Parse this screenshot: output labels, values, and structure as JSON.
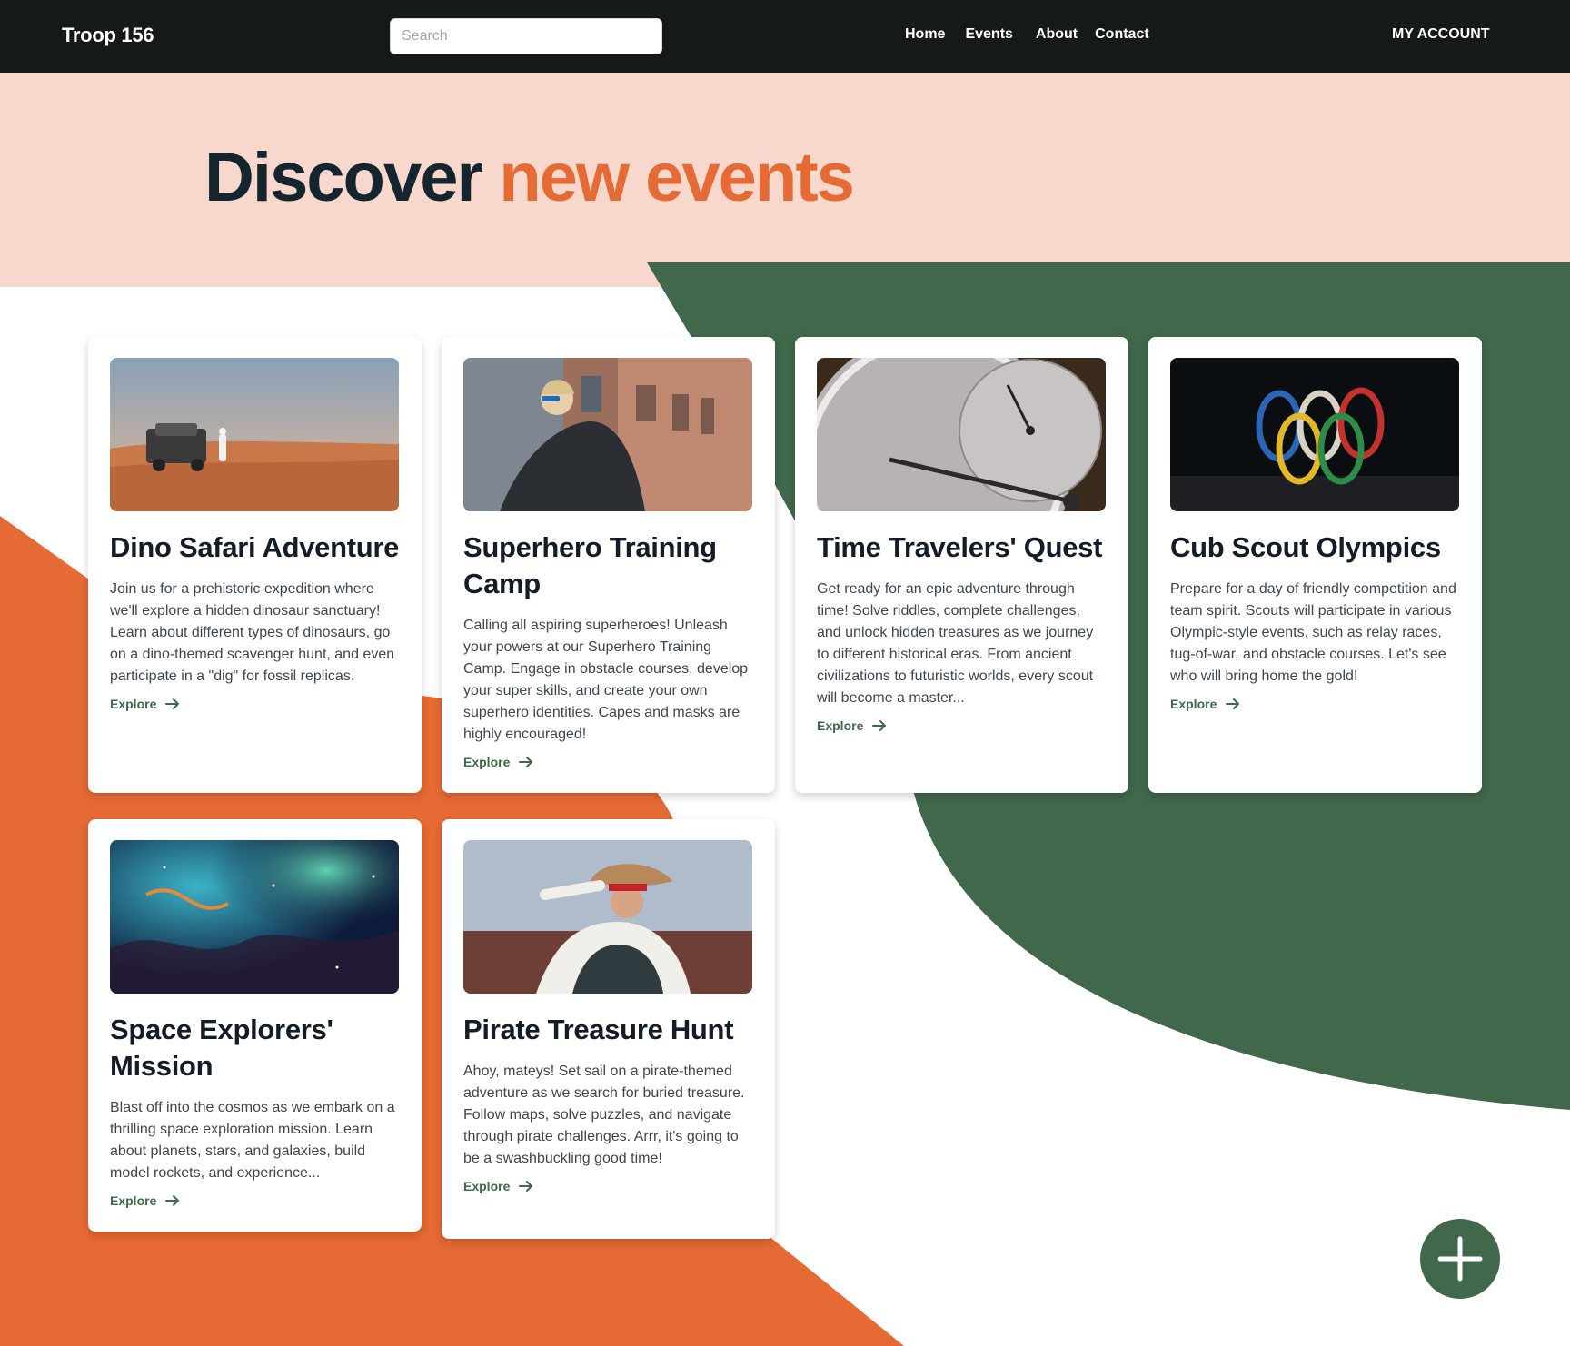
{
  "nav": {
    "brand": "Troop 156",
    "search_placeholder": "Search",
    "links": [
      "Home",
      "Events",
      "About",
      "Contact"
    ],
    "account": "MY ACCOUNT"
  },
  "hero": {
    "title_part1": "Discover",
    "title_part2": "new events"
  },
  "colors": {
    "nav_bg": "#151a16",
    "hero_bg": "#f8d8cd",
    "accent_orange": "#e66a33",
    "forest_green": "#41684a",
    "title_dark": "#14252e"
  },
  "events": [
    {
      "title": "Dino Safari Adventure",
      "description": "Join us for a prehistoric expedition where we'll explore a hidden dinosaur sanctuary! Learn about different types of dinosaurs, go on a dino-themed scavenger hunt, and even participate in a \"dig\" for fossil replicas.",
      "cta": "Explore"
    },
    {
      "title": "Superhero Training Camp",
      "description": "Calling all aspiring superheroes! Unleash your powers at our Superhero Training Camp. Engage in obstacle courses, develop your super skills, and create your own superhero identities. Capes and masks are highly encouraged!",
      "cta": "Explore"
    },
    {
      "title": "Time Travelers' Quest",
      "description": "Get ready for an epic adventure through time! Solve riddles, complete challenges, and unlock hidden treasures as we journey to different historical eras. From ancient civilizations to futuristic worlds, every scout will become a master...",
      "cta": "Explore"
    },
    {
      "title": "Cub Scout Olympics",
      "description": "Prepare for a day of friendly competition and team spirit. Scouts will participate in various Olympic-style events, such as relay races, tug-of-war, and obstacle courses. Let's see who will bring home the gold!",
      "cta": "Explore"
    },
    {
      "title": "Space Explorers' Mission",
      "description": "Blast off into the cosmos as we embark on a thrilling space exploration mission. Learn about planets, stars, and galaxies, build model rockets, and experience...",
      "cta": "Explore"
    },
    {
      "title": "Pirate Treasure Hunt",
      "description": "Ahoy, mateys! Set sail on a pirate-themed adventure as we search for buried treasure. Follow maps, solve puzzles, and navigate through pirate challenges. Arrr, it's going to be a swashbuckling good time!",
      "cta": "Explore"
    }
  ],
  "fab_icon": "plus-icon"
}
